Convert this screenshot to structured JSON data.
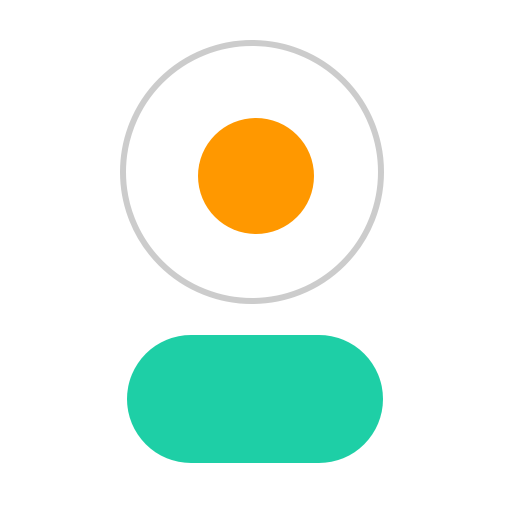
{
  "colors": {
    "background": "#ffffff",
    "ring": "#cccccc",
    "dot": "#ff9800",
    "pill": "#1ecfa6"
  },
  "icon": {
    "name": "camera-shutter-icon",
    "parts": [
      "outer-ring",
      "orange-dot",
      "green-pill"
    ]
  }
}
